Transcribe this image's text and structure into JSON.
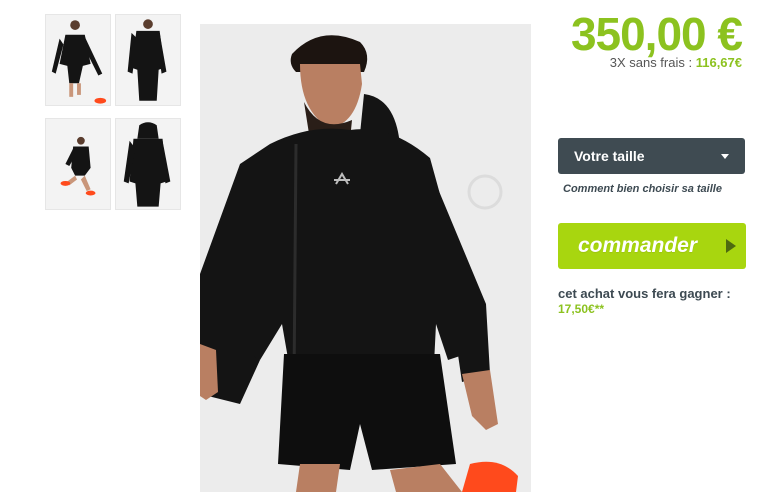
{
  "product": {
    "price": "350,00 €",
    "installments_label": "3X sans frais :",
    "installments_amount": "116,67€",
    "thumbnails": [
      {
        "alt": "front-view-jumping"
      },
      {
        "alt": "front-view-standing"
      },
      {
        "alt": "action-view-kick"
      },
      {
        "alt": "back-view-hood"
      }
    ],
    "main_image": "model-wearing-black-jacket",
    "watermark": "fr"
  },
  "size_selector": {
    "label": "Votre taille",
    "help_link": "Comment bien choisir sa taille"
  },
  "order": {
    "button_label": "commander"
  },
  "reward": {
    "text": "cet achat vous fera gagner :",
    "amount": "17,50€**"
  },
  "colors": {
    "accent_green": "#8cc21f",
    "button_green": "#a8d60f",
    "select_bg": "#3f4b52",
    "jacket": "#141414",
    "shoe_orange": "#ff4a1c"
  }
}
